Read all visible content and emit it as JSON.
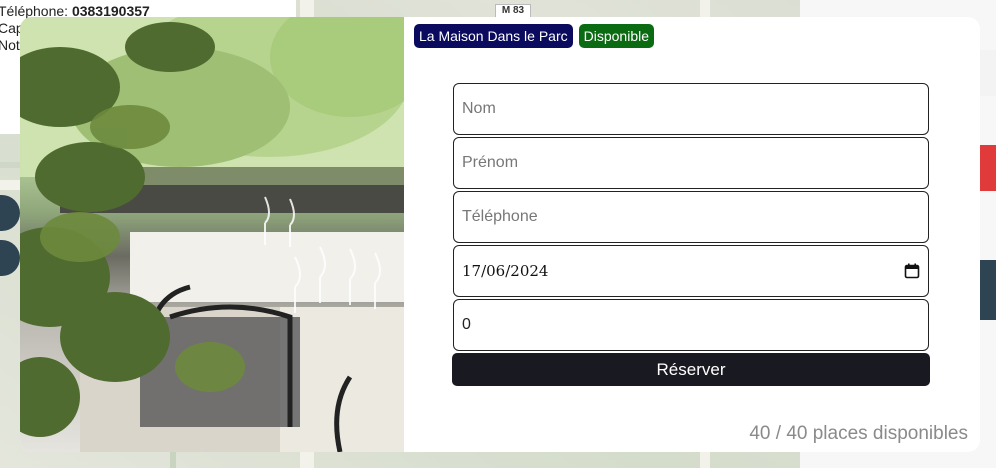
{
  "background": {
    "info": {
      "phone_label": "Téléphone:",
      "phone_value": "0383190357",
      "line2": "Cap",
      "line3": "Note"
    },
    "map_label": "M 83"
  },
  "modal": {
    "badges": {
      "name": "La Maison Dans le Parc",
      "status": "Disponible"
    },
    "form": {
      "nom_placeholder": "Nom",
      "prenom_placeholder": "Prénom",
      "telephone_placeholder": "Téléphone",
      "date_value": "17/06/2024",
      "guests_value": "0",
      "submit_label": "Réserver"
    },
    "availability": "40 / 40 places disponibles"
  },
  "colors": {
    "badge_name_bg": "#0a0a5e",
    "badge_status_bg": "#0a6b12",
    "submit_bg": "#191922"
  },
  "icons": {
    "calendar": "calendar-icon"
  }
}
